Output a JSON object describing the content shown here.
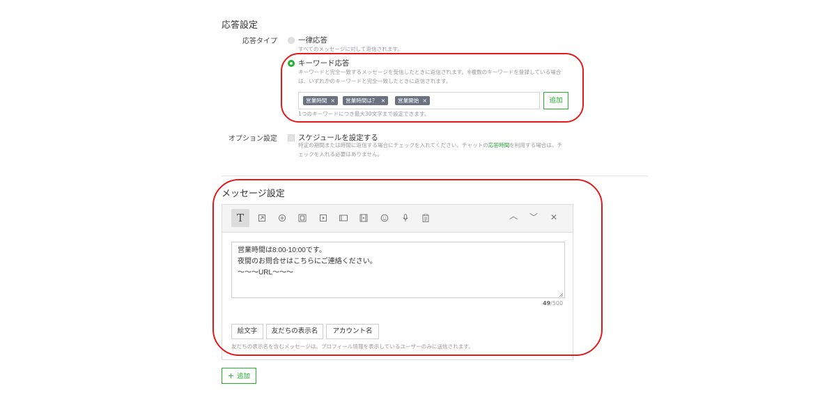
{
  "response_settings": {
    "section_title": "応答設定",
    "response_type_label": "応答タイプ",
    "uniform": {
      "label": "一律応答",
      "description": "すべてのメッセージに対して返信されます。",
      "selected": false
    },
    "keyword": {
      "label": "キーワード応答",
      "description_line1": "キーワードと完全一致するメッセージを受信したときに返信されます。※複数のキーワードを登録している場合",
      "description_line2": "は、いずれかのキーワードと完全一致したときに返信されます。",
      "selected": true,
      "tags": [
        "営業時間",
        "営業時間は？",
        "営業開始"
      ],
      "tag_remove_glyph": "×",
      "add_button": "追加",
      "note": "1つのキーワードにつき最大30文字まで設定できます。"
    },
    "option_label": "オプション設定",
    "schedule": {
      "label": "スケジュールを設定する",
      "desc_part1": "特定の期間または時間に返信する場合にチェックを入れてください。チャットの",
      "desc_link": "応答時間",
      "desc_part2": "を利用する場合は、チ",
      "desc_line2": "ェックを入れる必要はありません。",
      "checked": false
    }
  },
  "message_settings": {
    "section_title": "メッセージ設定",
    "toolbar": {
      "text_glyph": "T",
      "icons": [
        "sticker-icon",
        "coupon-icon",
        "rich-message-icon",
        "video-icon",
        "card-message-icon",
        "rich-video-icon",
        "emoji-face-icon",
        "microphone-icon",
        "clipboard-icon"
      ],
      "up_glyph": "︿",
      "down_glyph": "﹀",
      "close_glyph": "✕"
    },
    "message_text": "営業時間は8:00-10:00です。\n夜間のお問合せはこちらにご連絡ください。\n〜〜〜URL〜〜〜",
    "count_current": "49",
    "count_max": "/500",
    "insert_buttons": [
      "絵文字",
      "友だちの表示名",
      "アカウント名"
    ],
    "note": "友だちの表示名を含むメッセージは、プロフィール情報を表示しているユーザーのみに送信されます。",
    "add_button": "追加",
    "add_glyph": "+"
  },
  "colors": {
    "accent_green": "#20b52b",
    "annotation_red": "#e31a1a",
    "tag_gray": "#6a7282"
  }
}
